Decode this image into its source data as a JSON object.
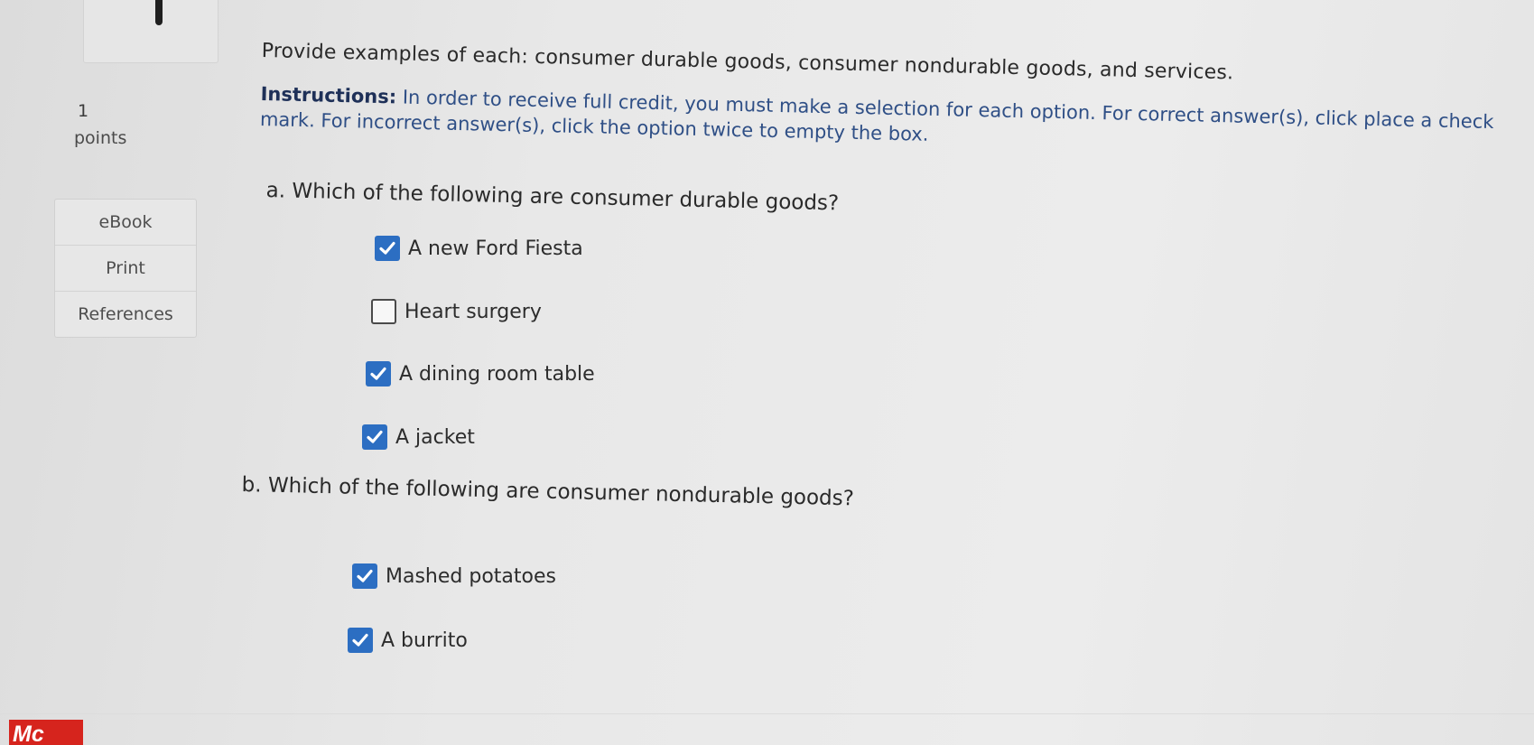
{
  "points": {
    "value": "1",
    "label": "points"
  },
  "side_panel": {
    "items": [
      "eBook",
      "Print",
      "References"
    ]
  },
  "question": {
    "prompt": "Provide examples of each: consumer durable goods, consumer nondurable goods, and services.",
    "instructions_label": "Instructions:",
    "instructions_text": " In order to receive full credit, you must make a selection for each option. For correct answer(s), click place a check mark. For incorrect answer(s), click the option twice to empty the box."
  },
  "part_a": {
    "title": "a. Which of the following are consumer durable goods?",
    "options": [
      {
        "label": "A new Ford Fiesta",
        "checked": true
      },
      {
        "label": "Heart surgery",
        "checked": false
      },
      {
        "label": "A dining room table",
        "checked": true
      },
      {
        "label": "A jacket",
        "checked": true
      }
    ]
  },
  "part_b": {
    "title": "b. Which of the following are consumer nondurable goods?",
    "options": [
      {
        "label": "Mashed potatoes",
        "checked": true
      },
      {
        "label": "A burrito",
        "checked": true
      }
    ]
  },
  "brand": {
    "logo_text": "Mc",
    "accent": "#d6241d",
    "check_color": "#2c6ec2"
  }
}
